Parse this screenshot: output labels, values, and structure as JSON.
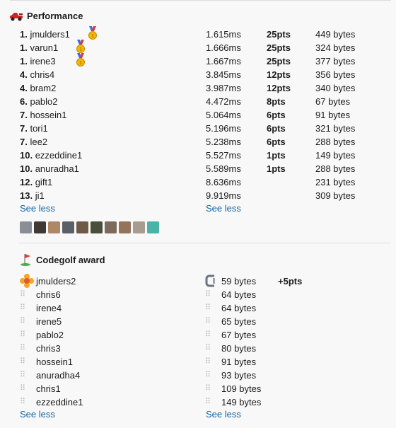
{
  "performance": {
    "title": "Performance",
    "entries": [
      {
        "rank": "1.",
        "name": "jmulders1",
        "time": "1.615ms",
        "pts": "25pts",
        "bytes": "449 bytes",
        "medal": true
      },
      {
        "rank": "1.",
        "name": "varun1",
        "time": "1.666ms",
        "pts": "25pts",
        "bytes": "324 bytes",
        "medal": true
      },
      {
        "rank": "1.",
        "name": "irene3",
        "time": "1.667ms",
        "pts": "25pts",
        "bytes": "377 bytes",
        "medal": true
      },
      {
        "rank": "4.",
        "name": "chris4",
        "time": "3.845ms",
        "pts": "12pts",
        "bytes": "356 bytes",
        "medal": false
      },
      {
        "rank": "4.",
        "name": "bram2",
        "time": "3.987ms",
        "pts": "12pts",
        "bytes": "340 bytes",
        "medal": false
      },
      {
        "rank": "6.",
        "name": "pablo2",
        "time": "4.472ms",
        "pts": "8pts",
        "bytes": "67 bytes",
        "medal": false
      },
      {
        "rank": "7.",
        "name": "hossein1",
        "time": "5.064ms",
        "pts": "6pts",
        "bytes": "91 bytes",
        "medal": false
      },
      {
        "rank": "7.",
        "name": "tori1",
        "time": "5.196ms",
        "pts": "6pts",
        "bytes": "321 bytes",
        "medal": false
      },
      {
        "rank": "7.",
        "name": "lee2",
        "time": "5.238ms",
        "pts": "6pts",
        "bytes": "288 bytes",
        "medal": false
      },
      {
        "rank": "10.",
        "name": "ezzeddine1",
        "time": "5.527ms",
        "pts": "1pts",
        "bytes": "149 bytes",
        "medal": false
      },
      {
        "rank": "10.",
        "name": "anuradha1",
        "time": "5.589ms",
        "pts": "1pts",
        "bytes": "288 bytes",
        "medal": false
      },
      {
        "rank": "12.",
        "name": "gift1",
        "time": "8.636ms",
        "pts": "",
        "bytes": "231 bytes",
        "medal": false
      },
      {
        "rank": "13.",
        "name": "ji1",
        "time": "9.919ms",
        "pts": "",
        "bytes": "309 bytes",
        "medal": false
      }
    ],
    "see_less_left": "See less",
    "see_less_right": "See less",
    "avatar_colors": [
      "#8a8f96",
      "#3f3a36",
      "#b08766",
      "#5b5f66",
      "#6f5a48",
      "#4a4f3c",
      "#7d6a5a",
      "#94735a",
      "#a89c90",
      "#4ab3a8"
    ]
  },
  "codegolf": {
    "title": "Codegolf award",
    "entries": [
      {
        "name": "jmulders2",
        "bytes": "59 bytes",
        "bonus": "+5pts",
        "winner": true
      },
      {
        "name": "chris6",
        "bytes": "64 bytes",
        "bonus": "",
        "winner": false
      },
      {
        "name": "irene4",
        "bytes": "64 bytes",
        "bonus": "",
        "winner": false
      },
      {
        "name": "irene5",
        "bytes": "65 bytes",
        "bonus": "",
        "winner": false
      },
      {
        "name": "pablo2",
        "bytes": "67 bytes",
        "bonus": "",
        "winner": false
      },
      {
        "name": "chris3",
        "bytes": "80 bytes",
        "bonus": "",
        "winner": false
      },
      {
        "name": "hossein1",
        "bytes": "91 bytes",
        "bonus": "",
        "winner": false
      },
      {
        "name": "anuradha4",
        "bytes": "93 bytes",
        "bonus": "",
        "winner": false
      },
      {
        "name": "chris1",
        "bytes": "109 bytes",
        "bonus": "",
        "winner": false
      },
      {
        "name": "ezzeddine1",
        "bytes": "149 bytes",
        "bonus": "",
        "winner": false
      }
    ],
    "see_less_left": "See less",
    "see_less_right": "See less"
  },
  "colors": {
    "link": "#1264a3",
    "text": "#1d1c1d",
    "background": "#f8f8f8",
    "grip": "#b7b7b7"
  },
  "icons": {
    "performance": "race-car-icon",
    "codegolf": "golf-flag-icon",
    "medal": "gold-medal-icon",
    "winner": "flower-icon",
    "bytes_badge": "c-clamp-icon",
    "grip": "drag-handle-icon"
  }
}
